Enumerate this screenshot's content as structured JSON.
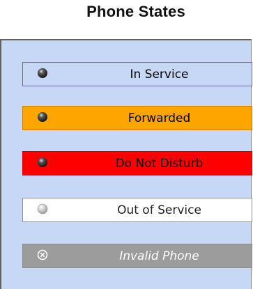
{
  "title": "Phone States",
  "states": [
    {
      "label": "In Service",
      "icon": "dark-status-light-icon"
    },
    {
      "label": "Forwarded",
      "icon": "dark-status-light-icon"
    },
    {
      "label": "Do Not Disturb",
      "icon": "dark-status-light-icon"
    },
    {
      "label": "Out of Service",
      "icon": "gray-status-light-icon"
    },
    {
      "label": "Invalid Phone",
      "icon": "invalid-circle-x-icon"
    }
  ],
  "colors": {
    "panel_background": "#c7d8f6",
    "in_service": "#c7d8f6",
    "forwarded": "#ffa500",
    "do_not_disturb": "#ff0000",
    "out_of_service": "#ffffff",
    "invalid_phone": "#9c9c9c"
  }
}
